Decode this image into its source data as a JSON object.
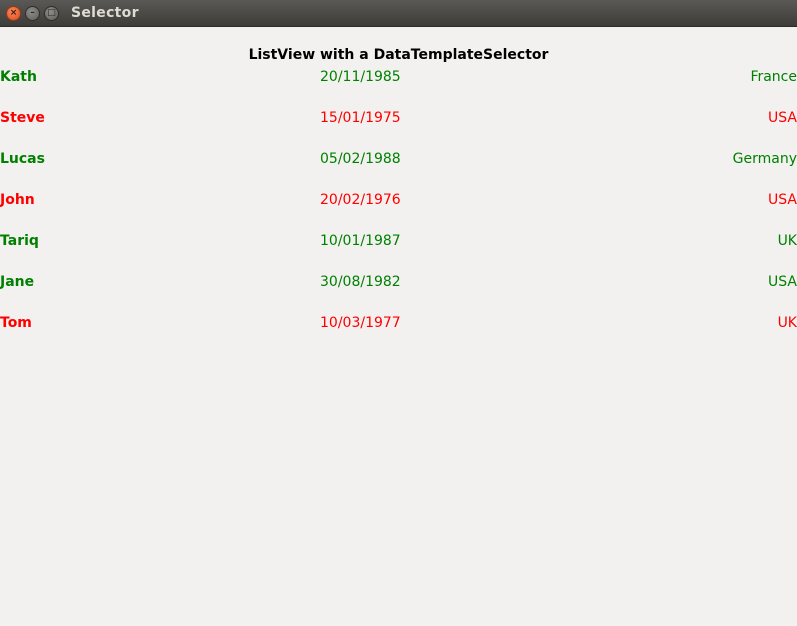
{
  "window": {
    "title": "Selector",
    "close_glyph": "×",
    "min_glyph": "–",
    "max_glyph": "□"
  },
  "header": {
    "title": "ListView with a DataTemplateSelector"
  },
  "colors": {
    "green": "#008000",
    "red": "#ff0000"
  },
  "people": [
    {
      "name": "Kath",
      "dob": "20/11/1985",
      "country": "France",
      "color": "green"
    },
    {
      "name": "Steve",
      "dob": "15/01/1975",
      "country": "USA",
      "color": "red"
    },
    {
      "name": "Lucas",
      "dob": "05/02/1988",
      "country": "Germany",
      "color": "green"
    },
    {
      "name": "John",
      "dob": "20/02/1976",
      "country": "USA",
      "color": "red"
    },
    {
      "name": "Tariq",
      "dob": "10/01/1987",
      "country": "UK",
      "color": "green"
    },
    {
      "name": "Jane",
      "dob": "30/08/1982",
      "country": "USA",
      "color": "green"
    },
    {
      "name": "Tom",
      "dob": "10/03/1977",
      "country": "UK",
      "color": "red"
    }
  ]
}
